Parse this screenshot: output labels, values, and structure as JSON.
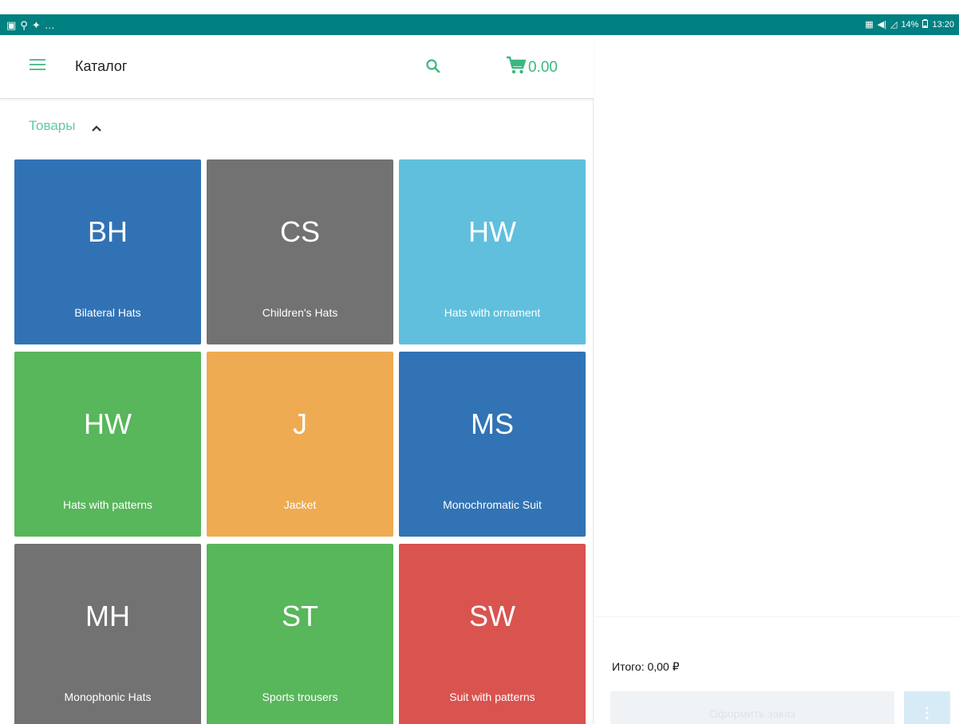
{
  "status_bar": {
    "left_icons": [
      "image-icon",
      "search-icon",
      "location-icon",
      "more-dots"
    ],
    "left_glyphs": [
      "▣",
      "⚲",
      "✦",
      "…"
    ],
    "right_glyphs": [
      "▦",
      "◀|",
      "◿"
    ],
    "battery": "14%",
    "time": "13:20"
  },
  "toolbar": {
    "title": "Каталог",
    "cart_total": "0.00"
  },
  "section": {
    "title": "Товары"
  },
  "products": [
    {
      "abbr": "BH",
      "name": "Bilateral Hats",
      "color": "#3172b5"
    },
    {
      "abbr": "CS",
      "name": "Children's Hats",
      "color": "#727272"
    },
    {
      "abbr": "HW",
      "name": "Hats with ornament",
      "color": "#5fbfdd"
    },
    {
      "abbr": "HW",
      "name": "Hats with patterns",
      "color": "#58b65b"
    },
    {
      "abbr": "J",
      "name": "Jacket",
      "color": "#eeab51"
    },
    {
      "abbr": "MS",
      "name": "Monochromatic Suit",
      "color": "#3173b4"
    },
    {
      "abbr": "MH",
      "name": "Monophonic Hats",
      "color": "#727272"
    },
    {
      "abbr": "ST",
      "name": "Sports trousers",
      "color": "#58b65b"
    },
    {
      "abbr": "SW",
      "name": "Suit with patterns",
      "color": "#d9534f"
    }
  ],
  "order": {
    "total_label": "Итого: 0,00 ₽",
    "checkout_label": "Оформить заказ"
  },
  "colors": {
    "status_bar": "#008080",
    "accent": "#58bf8f"
  }
}
